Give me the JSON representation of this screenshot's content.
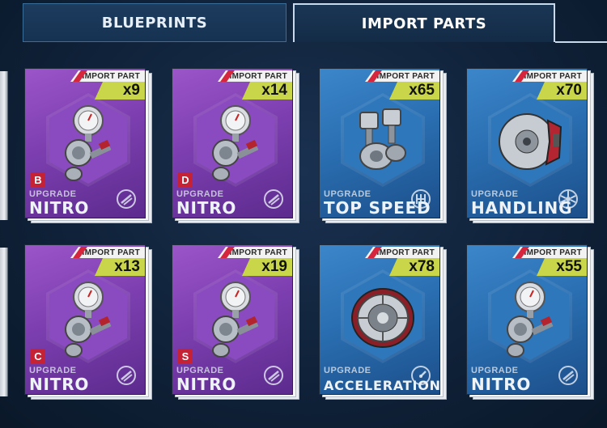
{
  "tabs": {
    "blueprints": "BLUEPRINTS",
    "import_parts": "IMPORT PARTS"
  },
  "cards": [
    {
      "tag": "IMPORT PART",
      "qty": "x9",
      "rank": "B",
      "upgrade": "UPGRADE",
      "part": "NITRO",
      "color": "purple",
      "icon": "nitro-icon",
      "art": "nitro-bottle"
    },
    {
      "tag": "IMPORT PART",
      "qty": "x14",
      "rank": "D",
      "upgrade": "UPGRADE",
      "part": "NITRO",
      "color": "purple",
      "icon": "nitro-icon",
      "art": "nitro-bottle"
    },
    {
      "tag": "IMPORT PART",
      "qty": "x65",
      "rank": "",
      "upgrade": "UPGRADE",
      "part": "TOP SPEED",
      "color": "blue",
      "icon": "gearshift-icon",
      "art": "pistons"
    },
    {
      "tag": "IMPORT PART",
      "qty": "x70",
      "rank": "",
      "upgrade": "UPGRADE",
      "part": "HANDLING",
      "color": "blue",
      "icon": "wheel-icon",
      "art": "brake-disc"
    },
    {
      "tag": "IMPORT PART",
      "qty": "x13",
      "rank": "C",
      "upgrade": "UPGRADE",
      "part": "NITRO",
      "color": "purple",
      "icon": "nitro-icon",
      "art": "nitro-bottle"
    },
    {
      "tag": "IMPORT PART",
      "qty": "x19",
      "rank": "S",
      "upgrade": "UPGRADE",
      "part": "NITRO",
      "color": "purple",
      "icon": "nitro-icon",
      "art": "nitro-bottle"
    },
    {
      "tag": "IMPORT PART",
      "qty": "x78",
      "rank": "",
      "upgrade": "UPGRADE",
      "part": "ACCELERATION",
      "color": "blue",
      "icon": "speedometer-icon",
      "art": "clutch"
    },
    {
      "tag": "IMPORT PART",
      "qty": "x55",
      "rank": "",
      "upgrade": "UPGRADE",
      "part": "NITRO",
      "color": "blue",
      "icon": "nitro-icon",
      "art": "nitro-bottle"
    }
  ]
}
